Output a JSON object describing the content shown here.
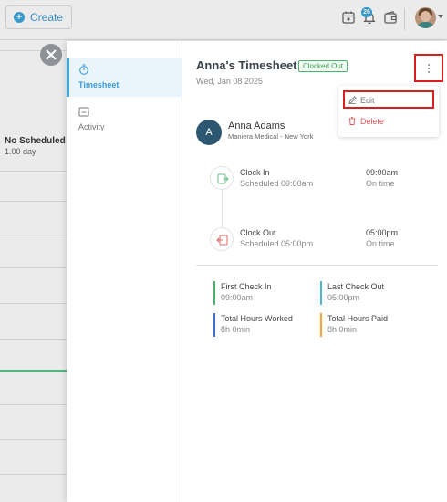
{
  "topbar": {
    "create_label": "Create",
    "notification_count": "26",
    "icons": [
      "schedule-icon",
      "bell-icon",
      "wallet-icon",
      "avatar",
      "chevron-down-icon"
    ]
  },
  "background": {
    "schedule_title": "No Scheduled Sh",
    "schedule_sub": "1.00 day"
  },
  "drawer": {
    "nav": [
      {
        "label": "Timesheet",
        "icon": "stopwatch-icon",
        "active": true
      },
      {
        "label": "Activity",
        "icon": "calendar-icon",
        "active": false
      }
    ],
    "title": "Anna's Timesheet",
    "status_badge": "Clocked Out",
    "date": "Wed, Jan 08 2025",
    "menu": {
      "edit_label": "Edit",
      "delete_label": "Delete"
    },
    "employee": {
      "initial": "A",
      "name": "Anna Adams",
      "org": "Maniera Medical - New York"
    },
    "timeline": [
      {
        "label": "Clock In",
        "scheduled": "Scheduled 09:00am",
        "time": "09:00am",
        "status": "On time"
      },
      {
        "label": "Clock Out",
        "scheduled": "Scheduled 05:00pm",
        "time": "05:00pm",
        "status": "On time"
      }
    ],
    "stats": [
      {
        "label": "First Check In",
        "value": "09:00am",
        "color": "#4cb36e"
      },
      {
        "label": "Last Check Out",
        "value": "05:00pm",
        "color": "#4bb8d8"
      },
      {
        "label": "Total Hours Worked",
        "value": "8h 0min",
        "color": "#3a6fc9"
      },
      {
        "label": "Total Hours Paid",
        "value": "8h 0min",
        "color": "#f0a830"
      }
    ]
  },
  "colors": {
    "accent": "#3ca6dc",
    "highlight": "#d62020",
    "delete": "#e0555a"
  }
}
